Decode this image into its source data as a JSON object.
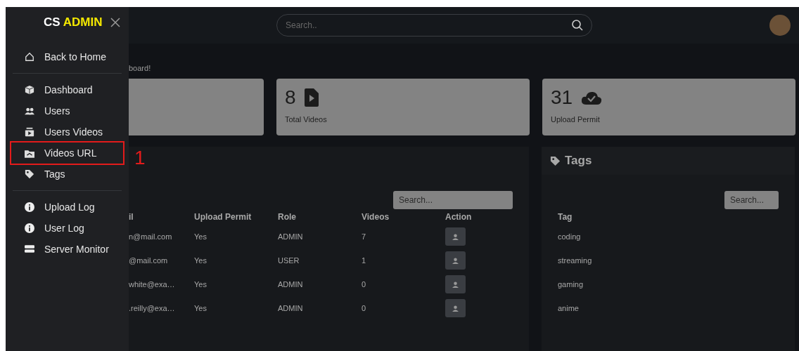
{
  "sidebar": {
    "brand_prefix": "CS",
    "brand_name": "ADMIN",
    "groups": [
      [
        {
          "label": "Back to Home",
          "annotated": false
        }
      ],
      [
        {
          "label": "Dashboard",
          "annotated": false
        },
        {
          "label": "Users",
          "annotated": false
        },
        {
          "label": "Users Videos",
          "annotated": false
        },
        {
          "label": "Videos URL",
          "annotated": true
        },
        {
          "label": "Tags",
          "annotated": false
        }
      ],
      [
        {
          "label": "Upload Log",
          "annotated": false
        },
        {
          "label": "User Log",
          "annotated": false
        },
        {
          "label": "Server Monitor",
          "annotated": false
        }
      ]
    ]
  },
  "annotation": {
    "label": "1"
  },
  "header": {
    "search": {
      "placeholder": "Search.."
    }
  },
  "welcome_text": "board!",
  "stats": [
    {
      "value": "8",
      "label": "Total Videos"
    },
    {
      "value": "31",
      "label": "Upload Permit"
    }
  ],
  "users_table": {
    "search": {
      "placeholder": "Search..."
    },
    "columns": [
      "il",
      "Upload Permit",
      "Role",
      "Videos",
      "Action"
    ],
    "rows": [
      [
        "n@mail.com",
        "Yes",
        "ADMIN",
        "7"
      ],
      [
        "@mail.com",
        "Yes",
        "USER",
        "1"
      ],
      [
        "white@exa…",
        "Yes",
        "ADMIN",
        "0"
      ],
      [
        ".reilly@exa…",
        "Yes",
        "ADMIN",
        "0"
      ]
    ]
  },
  "tags_panel": {
    "title": "Tags",
    "search": {
      "placeholder": "Search..."
    },
    "columns": [
      "Tag"
    ],
    "rows": [
      "coding",
      "streaming",
      "gaming",
      "anime"
    ]
  }
}
